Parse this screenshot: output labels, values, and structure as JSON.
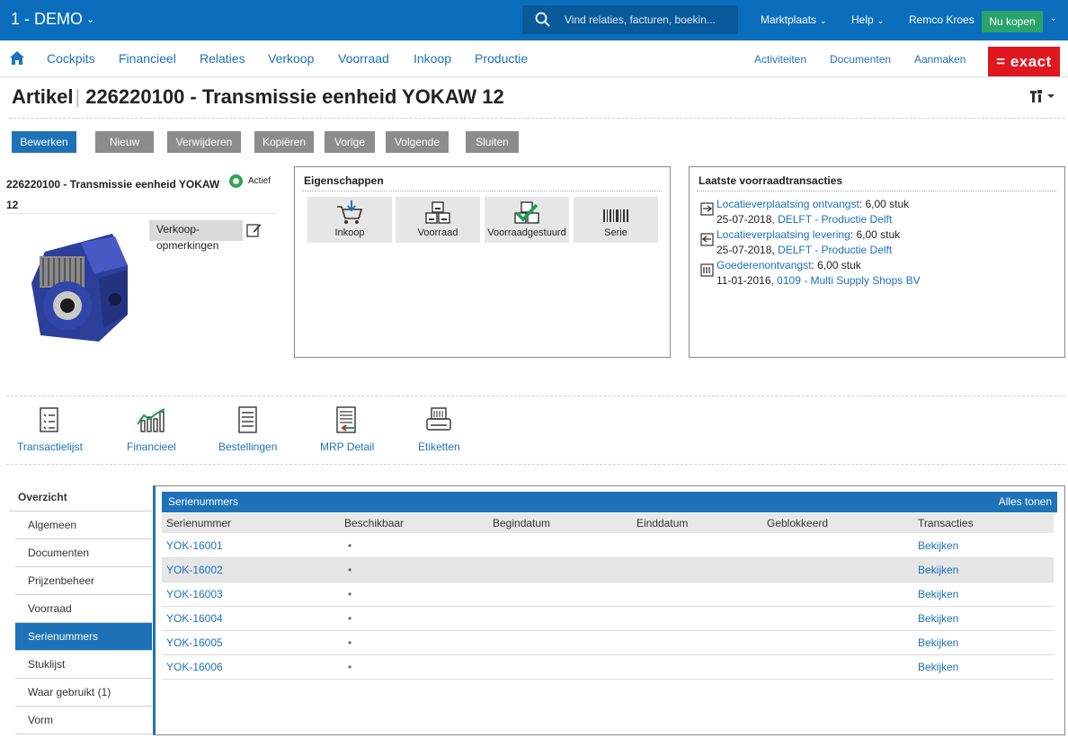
{
  "topbar": {
    "company": "1 - DEMO",
    "search_placeholder": "Vind relaties, facturen, boekin...",
    "marketplace": "Marktplaats",
    "help": "Help",
    "user": "Remco Kroes",
    "buy_now": "Nu kopen"
  },
  "nav": {
    "items": [
      "Cockpits",
      "Financieel",
      "Relaties",
      "Verkoop",
      "Voorraad",
      "Inkoop",
      "Productie"
    ],
    "right": [
      "Activiteiten",
      "Documenten",
      "Aanmaken"
    ],
    "logo": "= exact"
  },
  "title": {
    "prefix": "Artikel",
    "name": "226220100 - Transmissie eenheid YOKAW 12"
  },
  "buttons": [
    "Bewerken",
    "Nieuw",
    "Verwijderen",
    "Kopiëren",
    "Vorige",
    "Volgende",
    "Sluiten"
  ],
  "article": {
    "name": "226220100 - Transmissie eenheid YOKAW 12",
    "status": "Actief",
    "remarks_line1": "Verkoop-",
    "remarks_line2": "opmerkingen"
  },
  "properties": {
    "title": "Eigenschappen",
    "items": [
      "Inkoop",
      "Voorraad",
      "Voorraadgestuurd",
      "Serie"
    ]
  },
  "transactions": {
    "title": "Laatste voorraadtransacties",
    "items": [
      {
        "type": "Locatieverplaatsing ontvangst",
        "qty": "6,00 stuk",
        "date": "25-07-2018",
        "ref": "DELFT - Productie Delft"
      },
      {
        "type": "Locatieverplaatsing levering",
        "qty": "6,00 stuk",
        "date": "25-07-2018",
        "ref": "DELFT - Productie Delft"
      },
      {
        "type": "Goederenontvangst",
        "qty": "6,00 stuk",
        "date": "11-01-2016",
        "ref": "0109 - Multi Supply Shops BV"
      }
    ]
  },
  "shortcuts": [
    "Transactielijst",
    "Financieel",
    "Bestellingen",
    "MRP Detail",
    "Etiketten"
  ],
  "sidemenu": {
    "header": "Overzicht",
    "items": [
      "Algemeen",
      "Documenten",
      "Prijzenbeheer",
      "Voorraad",
      "Serienummers",
      "Stuklijst",
      "Waar gebruikt (1)",
      "Vorm"
    ],
    "active": "Serienummers"
  },
  "serials": {
    "title": "Serienummers",
    "show_all": "Alles tonen",
    "columns": [
      "Serienummer",
      "Beschikbaar",
      "Begindatum",
      "Einddatum",
      "Geblokkeerd",
      "Transacties"
    ],
    "rows": [
      {
        "serial": "YOK-16001",
        "available": "•",
        "action": "Bekijken"
      },
      {
        "serial": "YOK-16002",
        "available": "•",
        "action": "Bekijken"
      },
      {
        "serial": "YOK-16003",
        "available": "•",
        "action": "Bekijken"
      },
      {
        "serial": "YOK-16004",
        "available": "•",
        "action": "Bekijken"
      },
      {
        "serial": "YOK-16005",
        "available": "•",
        "action": "Bekijken"
      },
      {
        "serial": "YOK-16006",
        "available": "•",
        "action": "Bekijken"
      }
    ]
  },
  "colors": {
    "brand_blue": "#0a6ebd",
    "link": "#1d72b8",
    "buy_green": "#2aa36b",
    "exact_red": "#e0171f"
  }
}
